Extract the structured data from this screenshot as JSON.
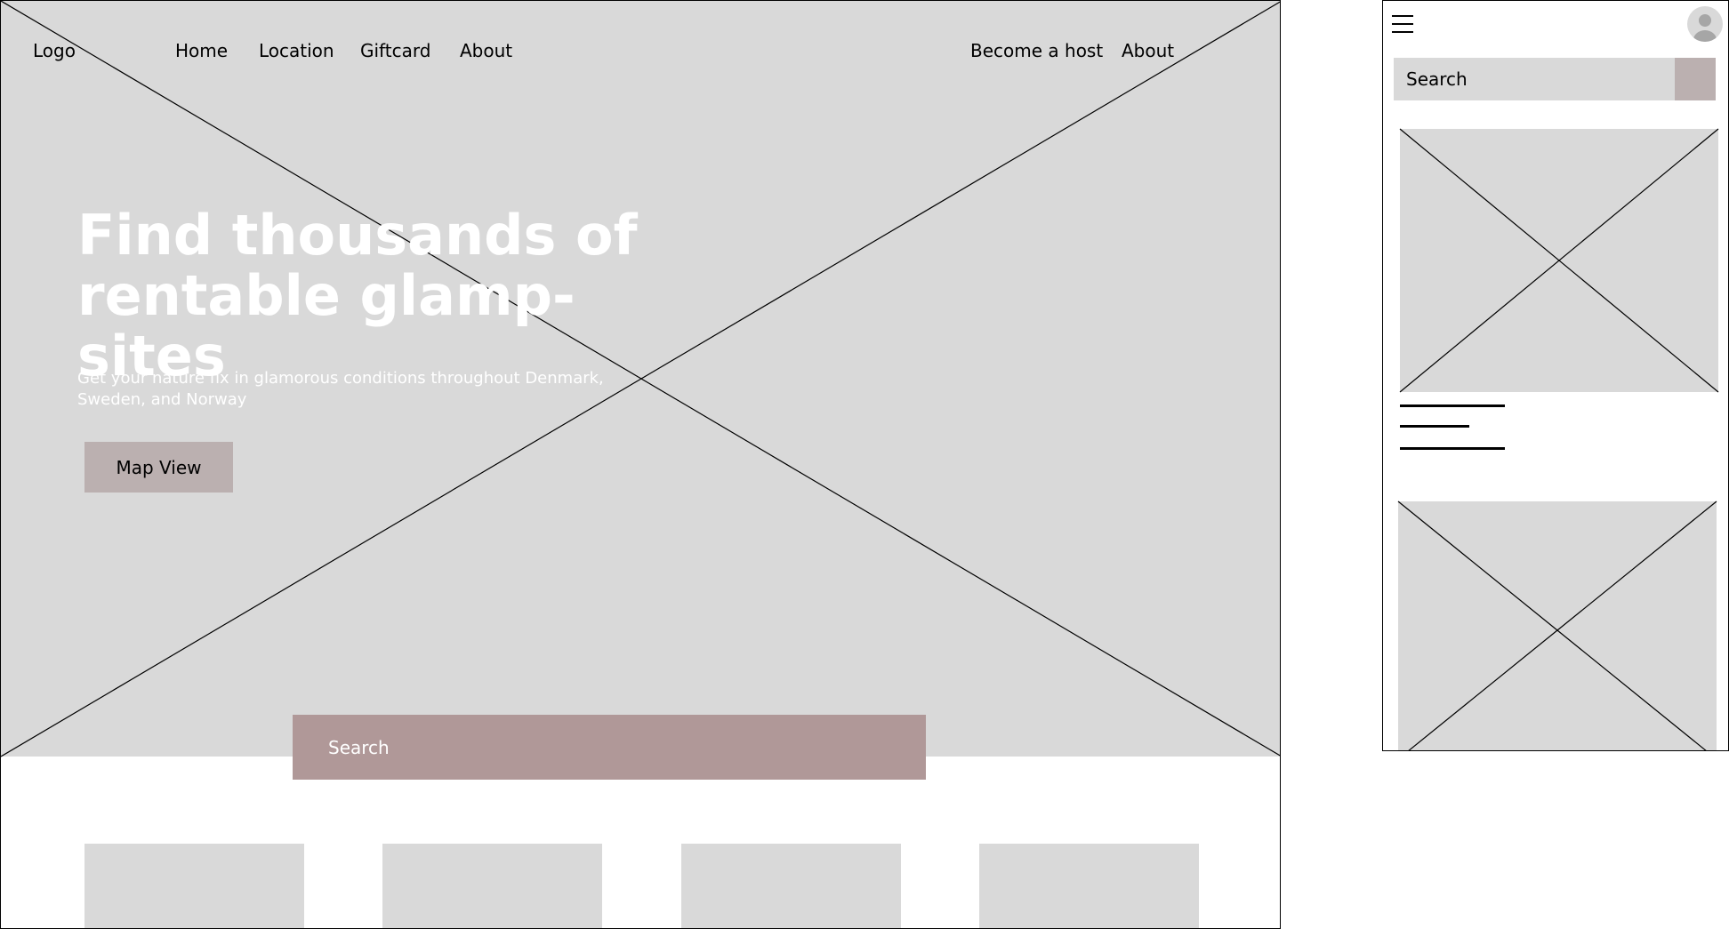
{
  "desktop": {
    "nav": {
      "logo": "Logo",
      "links": [
        "Home",
        "Location",
        "Giftcard",
        "About"
      ],
      "right_links": [
        "Become a host",
        "About"
      ]
    },
    "hero": {
      "title_line1": "Find thousands of",
      "title_line2": "rentable glamp-sites",
      "subtitle": "Get your nature fix in glamorous conditions throughout Denmark, Sweden, and Norway",
      "map_button": "Map View"
    },
    "search": {
      "label": "Search"
    },
    "cards_count": 4
  },
  "mobile": {
    "search": {
      "label": "Search"
    },
    "icons": {
      "menu": "hamburger-menu-icon",
      "user": "user-avatar-icon"
    }
  },
  "colors": {
    "placeholder_gray": "#d9d9d9",
    "button_mauve": "#bbb0b0",
    "search_mauve": "#b09898",
    "hero_text": "#ffffff"
  }
}
